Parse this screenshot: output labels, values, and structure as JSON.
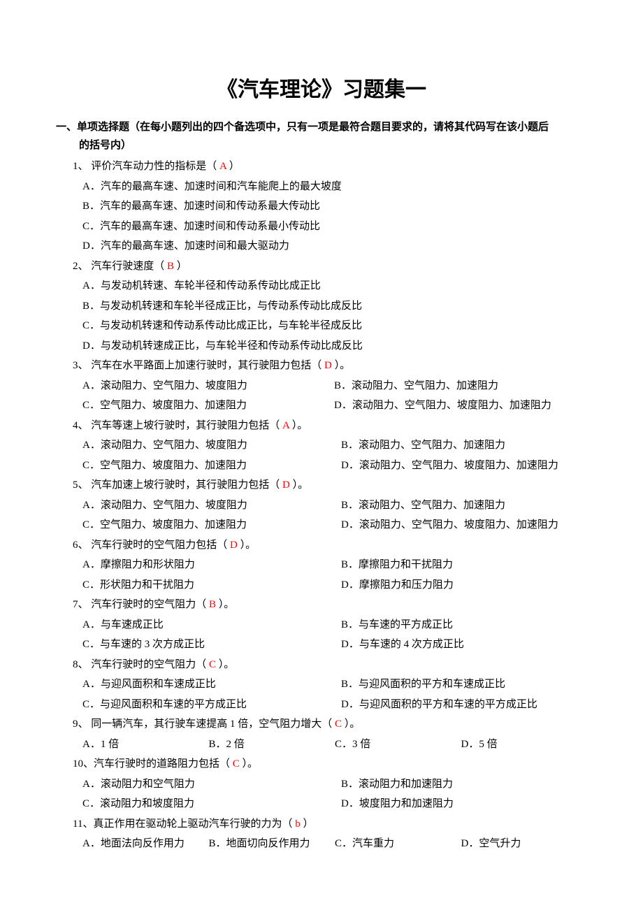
{
  "title": "《汽车理论》习题集一",
  "section1": {
    "heading_line1": "一、单项选择题（在每小题列出的四个备选项中，只有一项是最符合题目要求的，请将其代码写在该小题后",
    "heading_line2": "的括号内）"
  },
  "q1": {
    "stem_pre": "1、 评价汽车动力性的指标是（    ",
    "ans": "A",
    "stem_post": "    ）",
    "a": "A．汽车的最高车速、加速时间和汽车能爬上的最大坡度",
    "b": "B．汽车的最高车速、加速时间和传动系最大传动比",
    "c": "C．汽车的最高车速、加速时间和传动系最小传动比",
    "d": "D．汽车的最高车速、加速时间和最大驱动力"
  },
  "q2": {
    "stem_pre": "2、 汽车行驶速度（    ",
    "ans": "B",
    "stem_post": "    ）",
    "a": "A．与发动机转速、车轮半径和传动系传动比成正比",
    "b": "B．与发动机转速和车轮半径成正比，与传动系传动比成反比",
    "c": "C．与发动机转速和传动系传动比成正比，与车轮半径成反比",
    "d": "D．与发动机转速成正比，与车轮半径和传动系传动比成反比"
  },
  "q3": {
    "stem_pre": "3、 汽车在水平路面上加速行驶时，其行驶阻力包括（   ",
    "ans": "D",
    "stem_post": "   ）。",
    "a": "A．滚动阻力、空气阻力、坡度阻力",
    "b": "B．滚动阻力、空气阻力、加速阻力",
    "c": "C．空气阻力、坡度阻力、加速阻力",
    "d": "D．滚动阻力、空气阻力、坡度阻力、加速阻力"
  },
  "q4": {
    "stem_pre": "4、 汽车等速上坡行驶时，其行驶阻力包括（   ",
    "ans": "A",
    "stem_post": "  ）。",
    "a": "A．滚动阻力、空气阻力、坡度阻力",
    "b": "B．滚动阻力、空气阻力、加速阻力",
    "c": "C．空气阻力、坡度阻力、加速阻力",
    "d": "D．滚动阻力、空气阻力、坡度阻力、加速阻力"
  },
  "q5": {
    "stem_pre": "5、 汽车加速上坡行驶时，其行驶阻力包括（   ",
    "ans": "D",
    "stem_post": "  ）。",
    "a": "A．滚动阻力、空气阻力、坡度阻力",
    "b": "B．滚动阻力、空气阻力、加速阻力",
    "c": "C．空气阻力、坡度阻力、加速阻力",
    "d": "D．滚动阻力、空气阻力、坡度阻力、加速阻力"
  },
  "q6": {
    "stem_pre": "6、 汽车行驶时的空气阻力包括（ ",
    "ans": "D",
    "stem_post": "   ）。",
    "a": "A．摩擦阻力和形状阻力",
    "b": "B．摩擦阻力和干扰阻力",
    "c": "C．形状阻力和干扰阻力",
    "d": "D．摩擦阻力和压力阻力"
  },
  "q7": {
    "stem_pre": "7、 汽车行驶时的空气阻力（ ",
    "ans": "B",
    "stem_post": "   ）。",
    "a": "A．与车速成正比",
    "b": "B．与车速的平方成正比",
    "c": "C．与车速的 3 次方成正比",
    "d": "D．与车速的 4 次方成正比"
  },
  "q8": {
    "stem_pre": "8、 汽车行驶时的空气阻力（ ",
    "ans": "C",
    "stem_post": "    ）。",
    "a": "A．与迎风面积和车速成正比",
    "b": "B．与迎风面积的平方和车速成正比",
    "c": "C．与迎风面积和车速的平方成正比",
    "d": "D．与迎风面积的平方和车速的平方成正比"
  },
  "q9": {
    "stem_pre": "9、 同一辆汽车，其行驶车速提高 1 倍，空气阻力增大（ ",
    "ans": "C",
    "stem_post": "   ）。",
    "a": "A．1 倍",
    "b": "B．2 倍",
    "c": "C．3 倍",
    "d": "D．5 倍"
  },
  "q10": {
    "stem_pre": "10、汽车行驶时的道路阻力包括（ ",
    "ans": "C",
    "stem_post": "    ）。",
    "a": "A．滚动阻力和空气阻力",
    "b": "B．滚动阻力和加速阻力",
    "c": "C．滚动阻力和坡度阻力",
    "d": "D．坡度阻力和加速阻力"
  },
  "q11": {
    "stem_pre": "11、真正作用在驱动轮上驱动汽车行驶的力为（   ",
    "ans": "b",
    "stem_post": "    ）",
    "a": "A．地面法向反作用力",
    "b": "B．地面切向反作用力",
    "c": "C．汽车重力",
    "d": "D．空气升力"
  }
}
